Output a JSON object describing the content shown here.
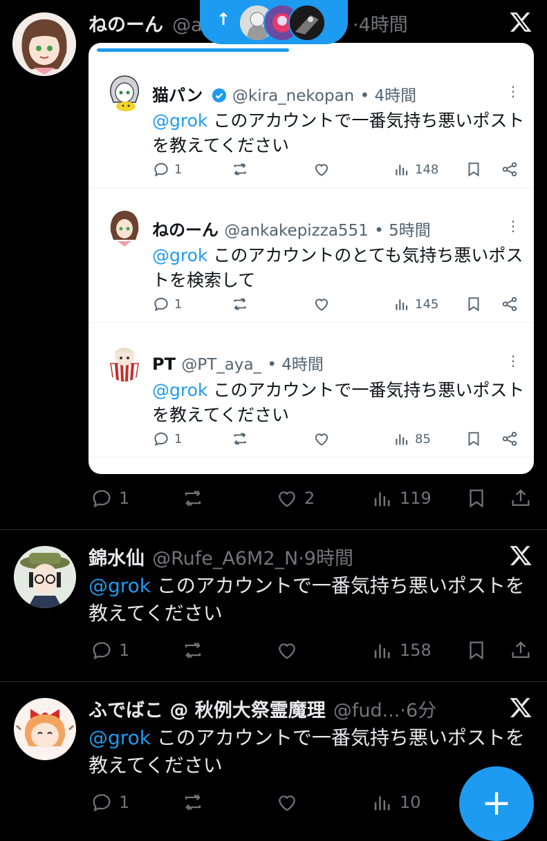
{
  "colors": {
    "accent": "#1d9bf0",
    "background": "#000000",
    "card": "#ffffff",
    "muted": "#71767b"
  },
  "new_posts_pill": {
    "arrow": "↑"
  },
  "posts": [
    {
      "name": "ねのーん",
      "handle": "@a",
      "time": "·4時間",
      "actions": {
        "replies": "1",
        "reposts": "",
        "likes": "2",
        "views": "119"
      },
      "quote_card": {
        "items": [
          {
            "name": "猫パン",
            "verified": true,
            "handle": "@kira_nekopan",
            "time": "• 4時間",
            "mention": "@grok",
            "text": " このアカウントで一番気持ち悪いポストを教えてください",
            "replies": "1",
            "views": "148"
          },
          {
            "name": "ねのーん",
            "verified": false,
            "handle": "@ankakepizza551",
            "time": "• 5時間",
            "mention": "@grok",
            "text": " このアカウントのとても気持ち悪いポストを検索して",
            "replies": "1",
            "views": "145"
          },
          {
            "name": "PT",
            "verified": false,
            "handle": "@PT_aya_",
            "time": "• 4時間",
            "mention": "@grok",
            "text": " このアカウントで一番気持ち悪いポストを教えてください",
            "replies": "1",
            "views": "85"
          }
        ]
      }
    },
    {
      "name": "錦水仙",
      "handle": "@Rufe_A6M2_N",
      "time": "·9時間",
      "mention": "@grok",
      "text": " このアカウントで一番気持ち悪いポストを教えてください",
      "actions": {
        "replies": "1",
        "views": "158"
      }
    },
    {
      "name": "ふでばこ @ 秋例大祭霊魔理",
      "handle": "@fud...",
      "time": "·6分",
      "mention": "@grok",
      "text": " このアカウントで一番気持ち悪いポストを教えてください",
      "actions": {
        "replies": "1",
        "views": "10"
      }
    }
  ],
  "fab": {
    "label": "+"
  }
}
